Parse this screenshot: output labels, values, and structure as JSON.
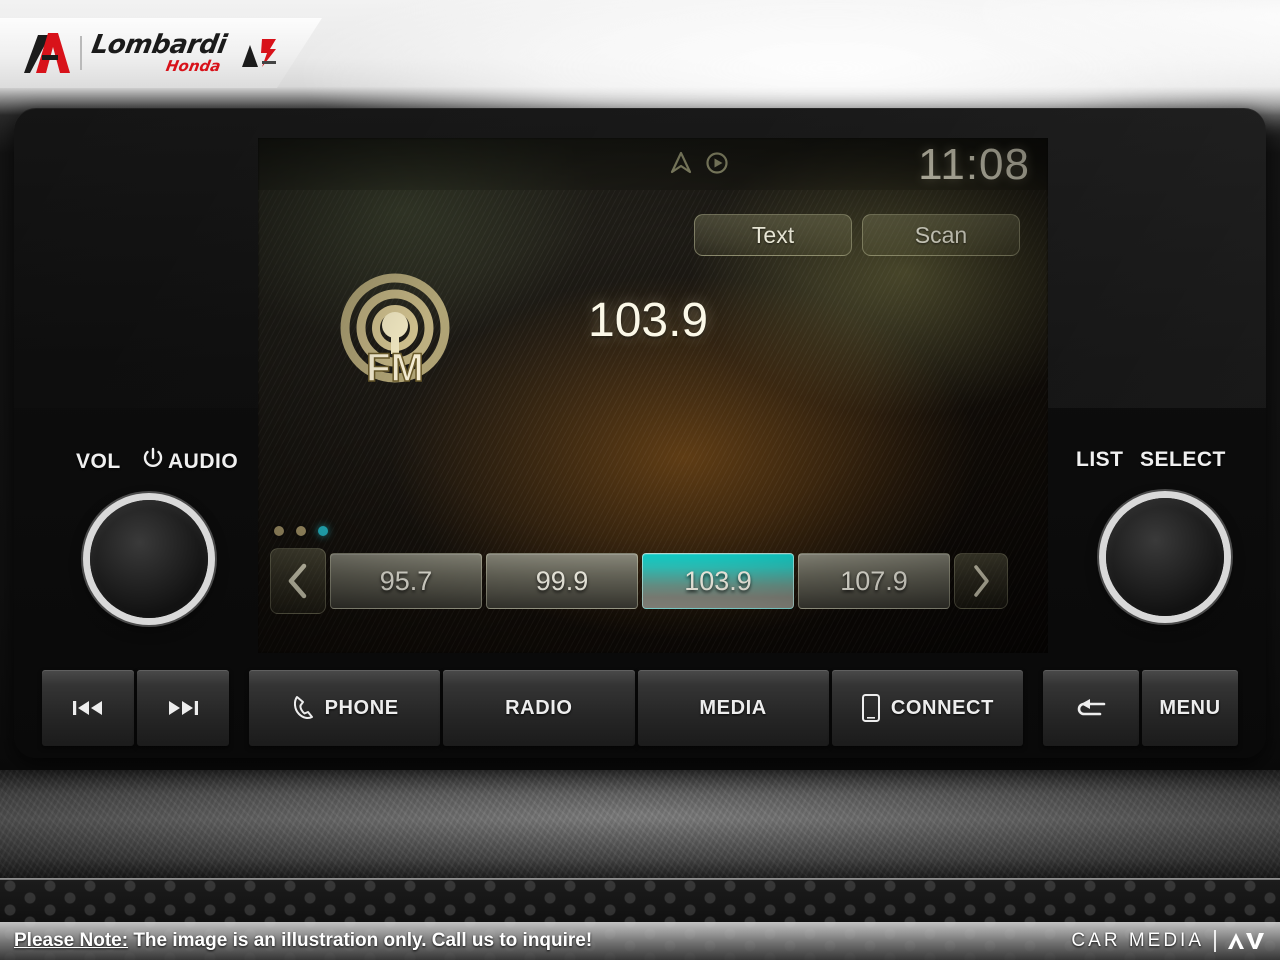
{
  "dealer": {
    "name": "Lombardi",
    "sub": "Honda",
    "logo_icon": "lombardi-a-mark-icon",
    "badge_icon": "dealer-award-badge-icon"
  },
  "head_unit": {
    "screen": {
      "status": {
        "clock": "11:08",
        "icons": [
          {
            "name": "navigation-arrow-icon",
            "glyph": "nav"
          },
          {
            "name": "media-play-circle-icon",
            "glyph": "play"
          }
        ]
      },
      "top_buttons": [
        {
          "name": "text-button",
          "label": "Text"
        },
        {
          "name": "scan-button",
          "label": "Scan"
        }
      ],
      "source": {
        "band_icon": "fm-broadcast-icon",
        "band_label": "FM",
        "frequency": "103.9"
      },
      "preset_pages": {
        "count": 3,
        "active_index": 2
      },
      "preset_nav": {
        "prev_icon": "chevron-left-icon",
        "next_icon": "chevron-right-icon"
      },
      "presets": [
        {
          "label": "95.7",
          "active": false
        },
        {
          "label": "99.9",
          "active": false
        },
        {
          "label": "103.9",
          "active": true
        },
        {
          "label": "107.9",
          "active": false
        }
      ]
    },
    "left_knob": {
      "label_vol": "VOL",
      "label_audio": "AUDIO",
      "power_icon": "power-icon",
      "knob_name": "volume-audio-knob"
    },
    "right_knob": {
      "label_list": "LIST",
      "label_select": "SELECT",
      "knob_name": "list-select-knob"
    },
    "hard_keys": [
      {
        "name": "previous-track-button",
        "label": "",
        "icon": "previous-track-icon"
      },
      {
        "name": "next-track-button",
        "label": "",
        "icon": "next-track-icon"
      },
      {
        "name": "phone-button",
        "label": "PHONE",
        "icon": "phone-handset-icon"
      },
      {
        "name": "radio-button",
        "label": "RADIO",
        "icon": ""
      },
      {
        "name": "media-button",
        "label": "MEDIA",
        "icon": ""
      },
      {
        "name": "connect-button",
        "label": "CONNECT",
        "icon": "smartphone-icon"
      },
      {
        "name": "back-button",
        "label": "",
        "icon": "back-arrow-icon"
      },
      {
        "name": "menu-button",
        "label": "MENU",
        "icon": ""
      }
    ]
  },
  "footer": {
    "note_prefix": "Please Note:",
    "note_text": " The image is an illustration only. Call us to inquire!",
    "brand": "CAR MEDIA",
    "brand_mark_icon": "av-logo-icon"
  },
  "colors": {
    "accent_teal": "#28c8d8",
    "screen_gold": "#d8c894",
    "brand_red": "#d8121a"
  }
}
